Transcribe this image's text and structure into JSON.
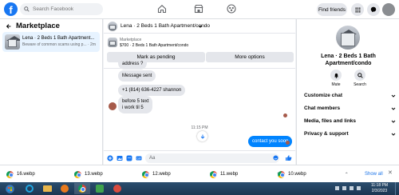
{
  "topbar": {
    "search_placeholder": "Search Facebook",
    "find_friends": "Find friends"
  },
  "sidebar": {
    "title": "Marketplace",
    "item": {
      "title": "Lena · 2 Beds 1 Bath Apartment...",
      "preview": "Beware of common scams using p... · 2m"
    }
  },
  "chat": {
    "header_title": "Lena · 2 Beds 1 Bath Apartment/condo",
    "listing": {
      "source": "Marketplace",
      "summary": "$700 · 2 Beds 1 Bath Apartment/condo",
      "mark_pending": "Mark as pending",
      "more_options": "More options"
    },
    "messages": {
      "m1": "address ?",
      "m2": "Message sent",
      "m3": "+1 (814) 636-4227 shannon",
      "m4a": "before 5 text",
      "m4b": "i work til 5",
      "timestamp": "11:15 PM",
      "outgoing": "contact you soon"
    },
    "composer_placeholder": "Aa"
  },
  "rightpane": {
    "title_line1": "Lena · 2 Beds 1 Bath",
    "title_line2": "Apartment/condo",
    "mute": "Mute",
    "search": "Search",
    "sections": [
      "Customize chat",
      "Chat members",
      "Media, files and links",
      "Privacy & support"
    ]
  },
  "downloads": {
    "files": [
      "16.webp",
      "13.webp",
      "12.webp",
      "11.webp",
      "10.webp"
    ],
    "show_all": "Show all"
  },
  "taskbar": {
    "time": "11:18 PM",
    "date": "2/3/2023"
  },
  "colors": {
    "brand": "#1877f2",
    "bubble_gray": "#e4e6eb",
    "selected_bg": "#e7f3ff"
  }
}
